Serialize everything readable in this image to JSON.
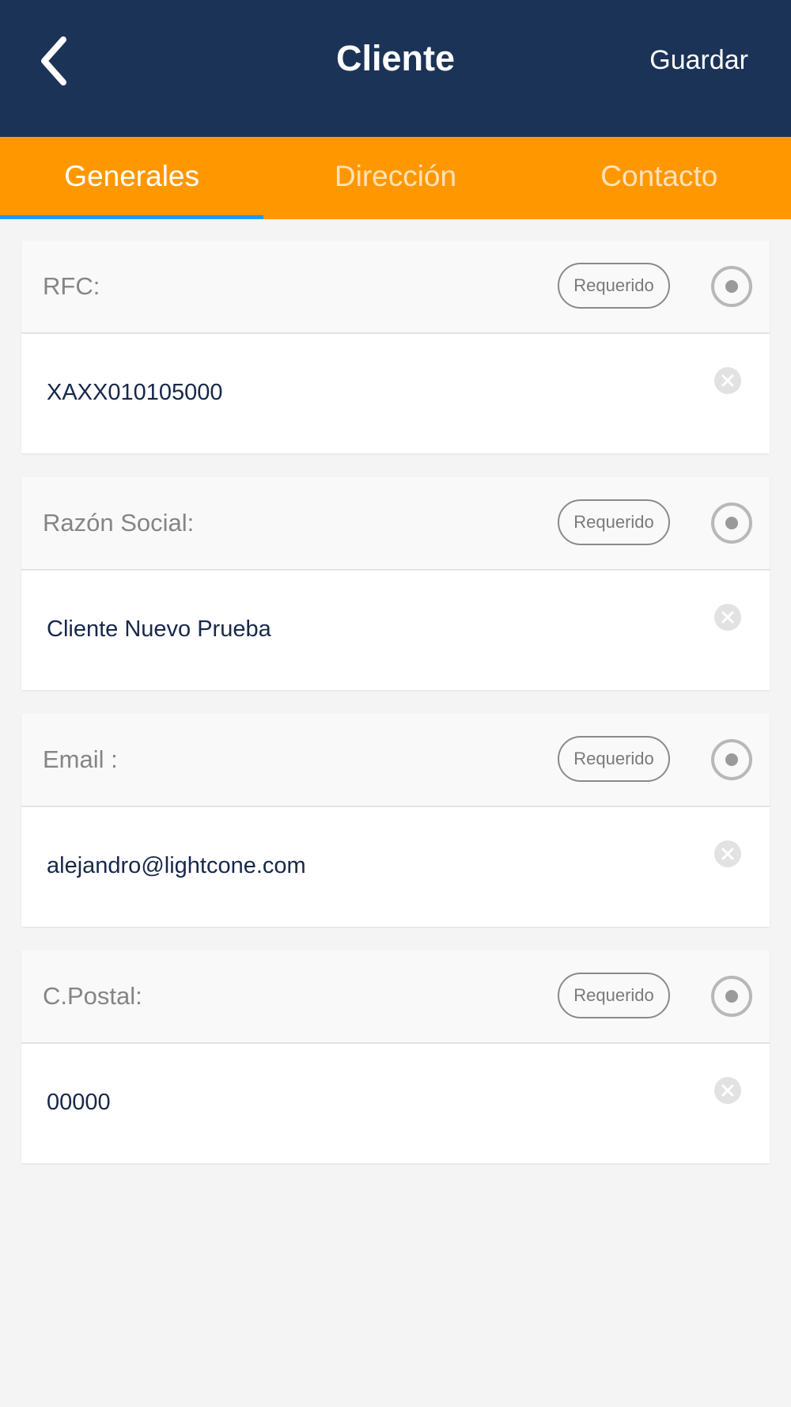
{
  "header": {
    "title": "Cliente",
    "save_label": "Guardar",
    "back_icon": "chevron-left-icon"
  },
  "tabs": [
    {
      "label": "Generales",
      "active": true
    },
    {
      "label": "Dirección",
      "active": false
    },
    {
      "label": "Contacto",
      "active": false
    }
  ],
  "fields": [
    {
      "label": "RFC:",
      "badge": "Requerido",
      "value": "XAXX010105000"
    },
    {
      "label": "Razón Social:",
      "badge": "Requerido",
      "value": "Cliente Nuevo Prueba"
    },
    {
      "label": "Email :",
      "badge": "Requerido",
      "value": "alejandro@lightcone.com"
    },
    {
      "label": "C.Postal:",
      "badge": "Requerido",
      "value": "00000"
    }
  ],
  "colors": {
    "header_bg": "#1b3357",
    "tab_bar_bg": "#ff9800",
    "tab_indicator": "#2196f3",
    "value_text": "#17284a",
    "label_text": "#858585"
  }
}
